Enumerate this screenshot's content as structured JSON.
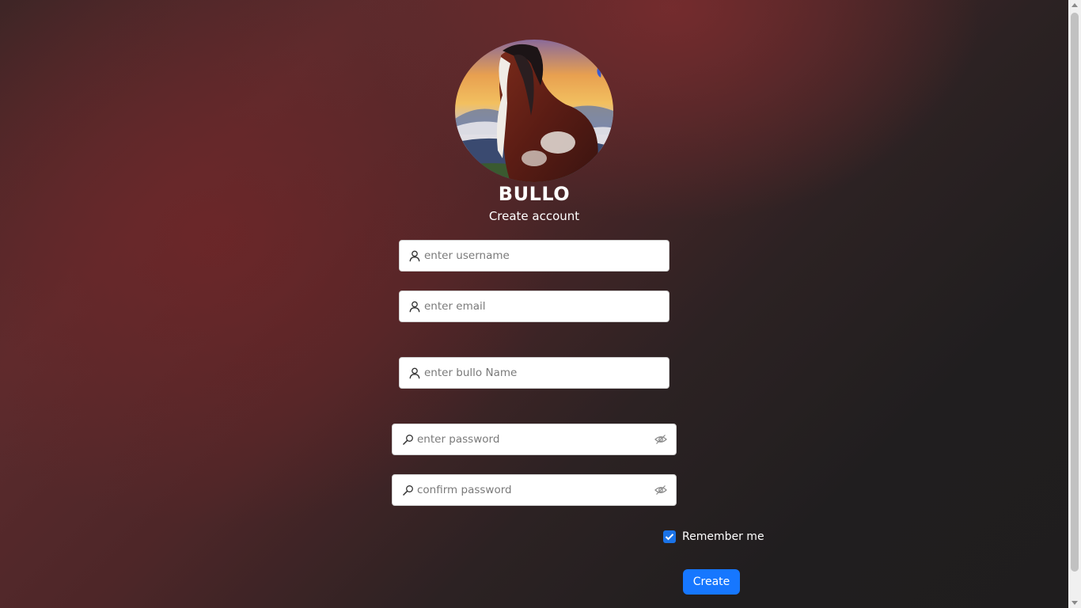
{
  "app": {
    "brand": "BULLO",
    "subtitle": "Create account"
  },
  "avatar": {
    "icon": "horse-portrait-image"
  },
  "form": {
    "username": {
      "placeholder": "enter username",
      "value": "",
      "icon": "user-icon"
    },
    "email": {
      "placeholder": "enter email",
      "value": "",
      "icon": "user-icon"
    },
    "bullo_name": {
      "placeholder": "enter bullo Name",
      "value": "",
      "icon": "user-icon"
    },
    "password": {
      "placeholder": "enter password",
      "value": "",
      "icon": "key-icon",
      "toggle_icon": "eye-hidden-icon"
    },
    "confirm_password": {
      "placeholder": "confirm password",
      "value": "",
      "icon": "key-icon",
      "toggle_icon": "eye-hidden-icon"
    },
    "remember": {
      "label": "Remember me",
      "checked": true
    },
    "submit_label": "Create"
  },
  "colors": {
    "accent": "#1677ff",
    "background_dark": "#1f1d1e",
    "background_red": "#5c2b2d"
  }
}
